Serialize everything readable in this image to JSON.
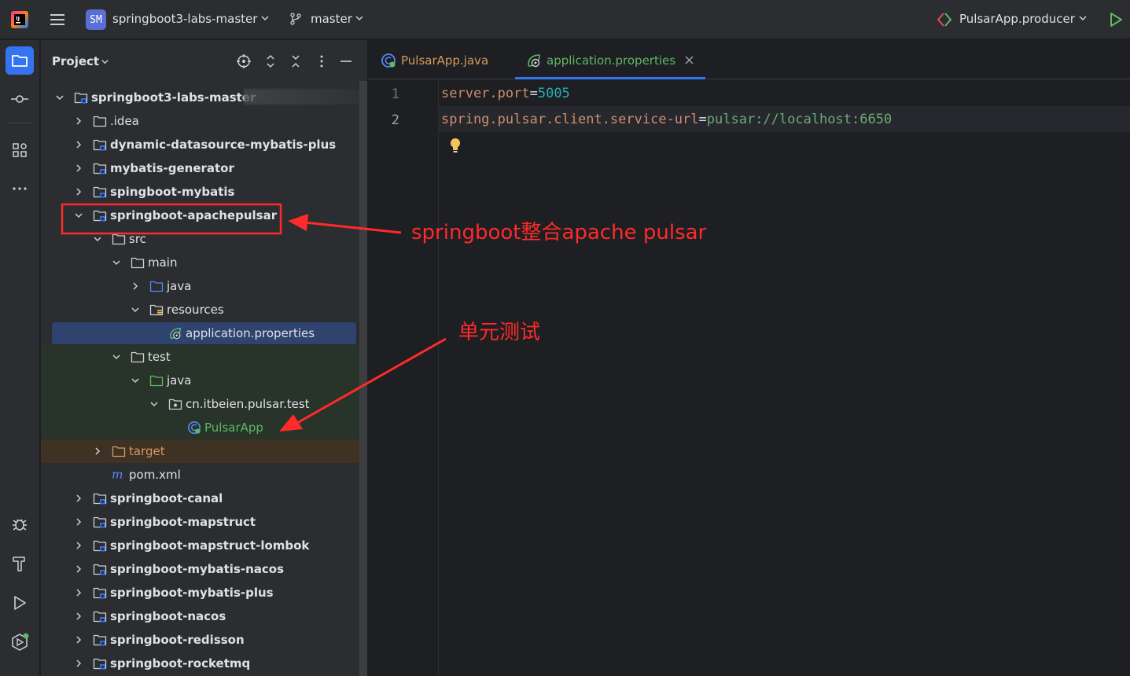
{
  "topbar": {
    "project_badge": "SM",
    "project_name": "springboot3-labs-master",
    "branch": "master",
    "run_config": "PulsarApp.producer"
  },
  "project_panel": {
    "title": "Project",
    "tree": [
      {
        "label": "springboot3-labs-master",
        "kind": "module",
        "expanded": true,
        "indent": 0
      },
      {
        "label": ".idea",
        "kind": "folder",
        "expanded": false,
        "indent": 1
      },
      {
        "label": "dynamic-datasource-mybatis-plus",
        "kind": "module",
        "expanded": false,
        "indent": 1
      },
      {
        "label": "mybatis-generator",
        "kind": "module",
        "expanded": false,
        "indent": 1
      },
      {
        "label": "spingboot-mybatis",
        "kind": "module",
        "expanded": false,
        "indent": 1
      },
      {
        "label": "springboot-apachepulsar",
        "kind": "module",
        "expanded": true,
        "indent": 1
      },
      {
        "label": "src",
        "kind": "folder",
        "expanded": true,
        "indent": 2
      },
      {
        "label": "main",
        "kind": "folder",
        "expanded": true,
        "indent": 3
      },
      {
        "label": "java",
        "kind": "src-folder",
        "expanded": false,
        "indent": 4
      },
      {
        "label": "resources",
        "kind": "res-folder",
        "expanded": true,
        "indent": 4
      },
      {
        "label": "application.properties",
        "kind": "properties",
        "indent": 5
      },
      {
        "label": "test",
        "kind": "folder",
        "expanded": true,
        "indent": 3
      },
      {
        "label": "java",
        "kind": "test-folder",
        "expanded": true,
        "indent": 4
      },
      {
        "label": "cn.itbeien.pulsar.test",
        "kind": "package",
        "expanded": true,
        "indent": 5
      },
      {
        "label": "PulsarApp",
        "kind": "class",
        "indent": 6
      },
      {
        "label": "target",
        "kind": "target-folder",
        "expanded": false,
        "indent": 2
      },
      {
        "label": "pom.xml",
        "kind": "maven",
        "indent": 2
      },
      {
        "label": "springboot-canal",
        "kind": "module",
        "expanded": false,
        "indent": 1
      },
      {
        "label": "springboot-mapstruct",
        "kind": "module",
        "expanded": false,
        "indent": 1
      },
      {
        "label": "springboot-mapstruct-lombok",
        "kind": "module",
        "expanded": false,
        "indent": 1
      },
      {
        "label": "springboot-mybatis-nacos",
        "kind": "module",
        "expanded": false,
        "indent": 1
      },
      {
        "label": "springboot-mybatis-plus",
        "kind": "module",
        "expanded": false,
        "indent": 1
      },
      {
        "label": "springboot-nacos",
        "kind": "module",
        "expanded": false,
        "indent": 1
      },
      {
        "label": "springboot-redisson",
        "kind": "module",
        "expanded": false,
        "indent": 1
      },
      {
        "label": "springboot-rocketmq",
        "kind": "module",
        "expanded": false,
        "indent": 1
      }
    ]
  },
  "editor": {
    "tabs": [
      {
        "label": "PulsarApp.java",
        "active": false
      },
      {
        "label": "application.properties",
        "active": true
      }
    ],
    "lines": [
      {
        "num": "1",
        "key": "server.port",
        "value": "5005"
      },
      {
        "num": "2",
        "key": "spring.pulsar.client.service-url",
        "value": "pulsar://localhost:6650"
      }
    ]
  },
  "annotations": {
    "pulsar_note": "springboot整合apache pulsar",
    "test_note": "单元测试",
    "color": "#ff2a2a"
  },
  "colors": {
    "accent": "#3574f0",
    "panel_bg": "#2b2d30",
    "editor_bg": "#1e1f22",
    "selection": "#2e436e"
  }
}
